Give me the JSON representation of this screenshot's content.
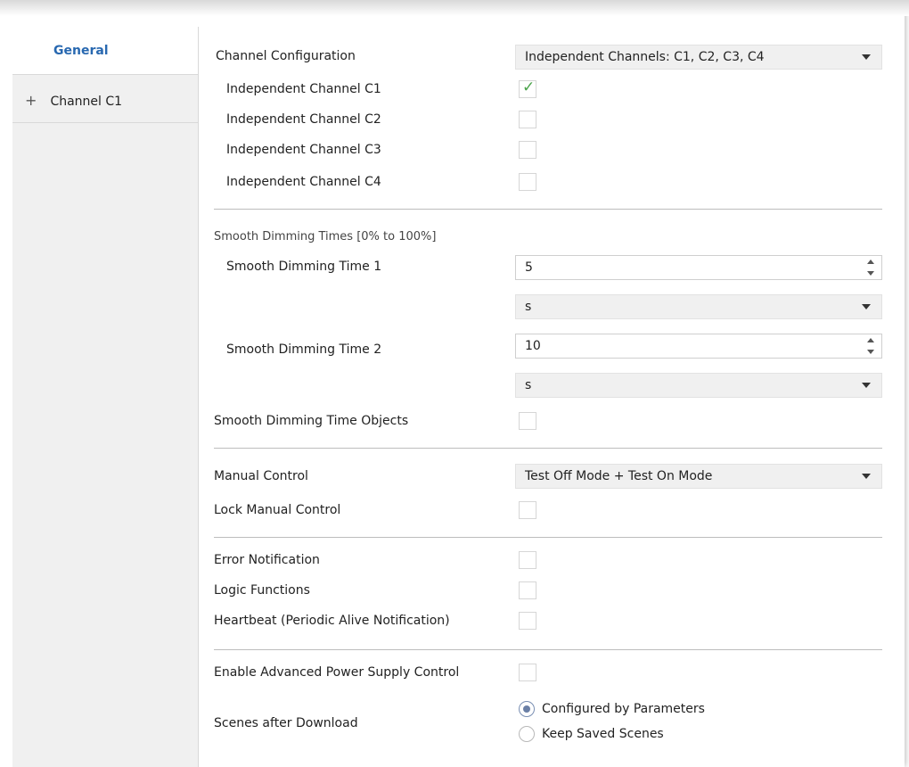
{
  "sidebar": {
    "items": [
      {
        "label": "General",
        "selected": true
      },
      {
        "label": "Channel C1",
        "expand_icon": "+"
      }
    ]
  },
  "channel_configuration": {
    "label": "Channel Configuration",
    "value": "Independent Channels: C1, C2, C3, C4"
  },
  "channels": [
    {
      "label": "Independent Channel C1",
      "checked": true
    },
    {
      "label": "Independent Channel C2",
      "checked": false
    },
    {
      "label": "Independent Channel C3",
      "checked": false
    },
    {
      "label": "Independent Channel C4",
      "checked": false
    }
  ],
  "smooth": {
    "section_title": "Smooth Dimming Times [0% to 100%]",
    "time1": {
      "label": "Smooth Dimming Time 1",
      "value": "5",
      "unit": "s"
    },
    "time2": {
      "label": "Smooth Dimming Time 2",
      "value": "10",
      "unit": "s"
    },
    "objects_label": "Smooth Dimming Time Objects"
  },
  "manual": {
    "label": "Manual Control",
    "value": "Test Off Mode + Test On Mode",
    "lock_label": "Lock Manual Control"
  },
  "notifications": {
    "error": "Error Notification",
    "logic": "Logic Functions",
    "heartbeat": "Heartbeat (Periodic Alive Notification)"
  },
  "power": {
    "label": "Enable Advanced Power Supply Control"
  },
  "scenes": {
    "label": "Scenes after Download",
    "options": [
      "Configured by Parameters",
      "Keep Saved Scenes"
    ],
    "selected": "Configured by Parameters"
  }
}
